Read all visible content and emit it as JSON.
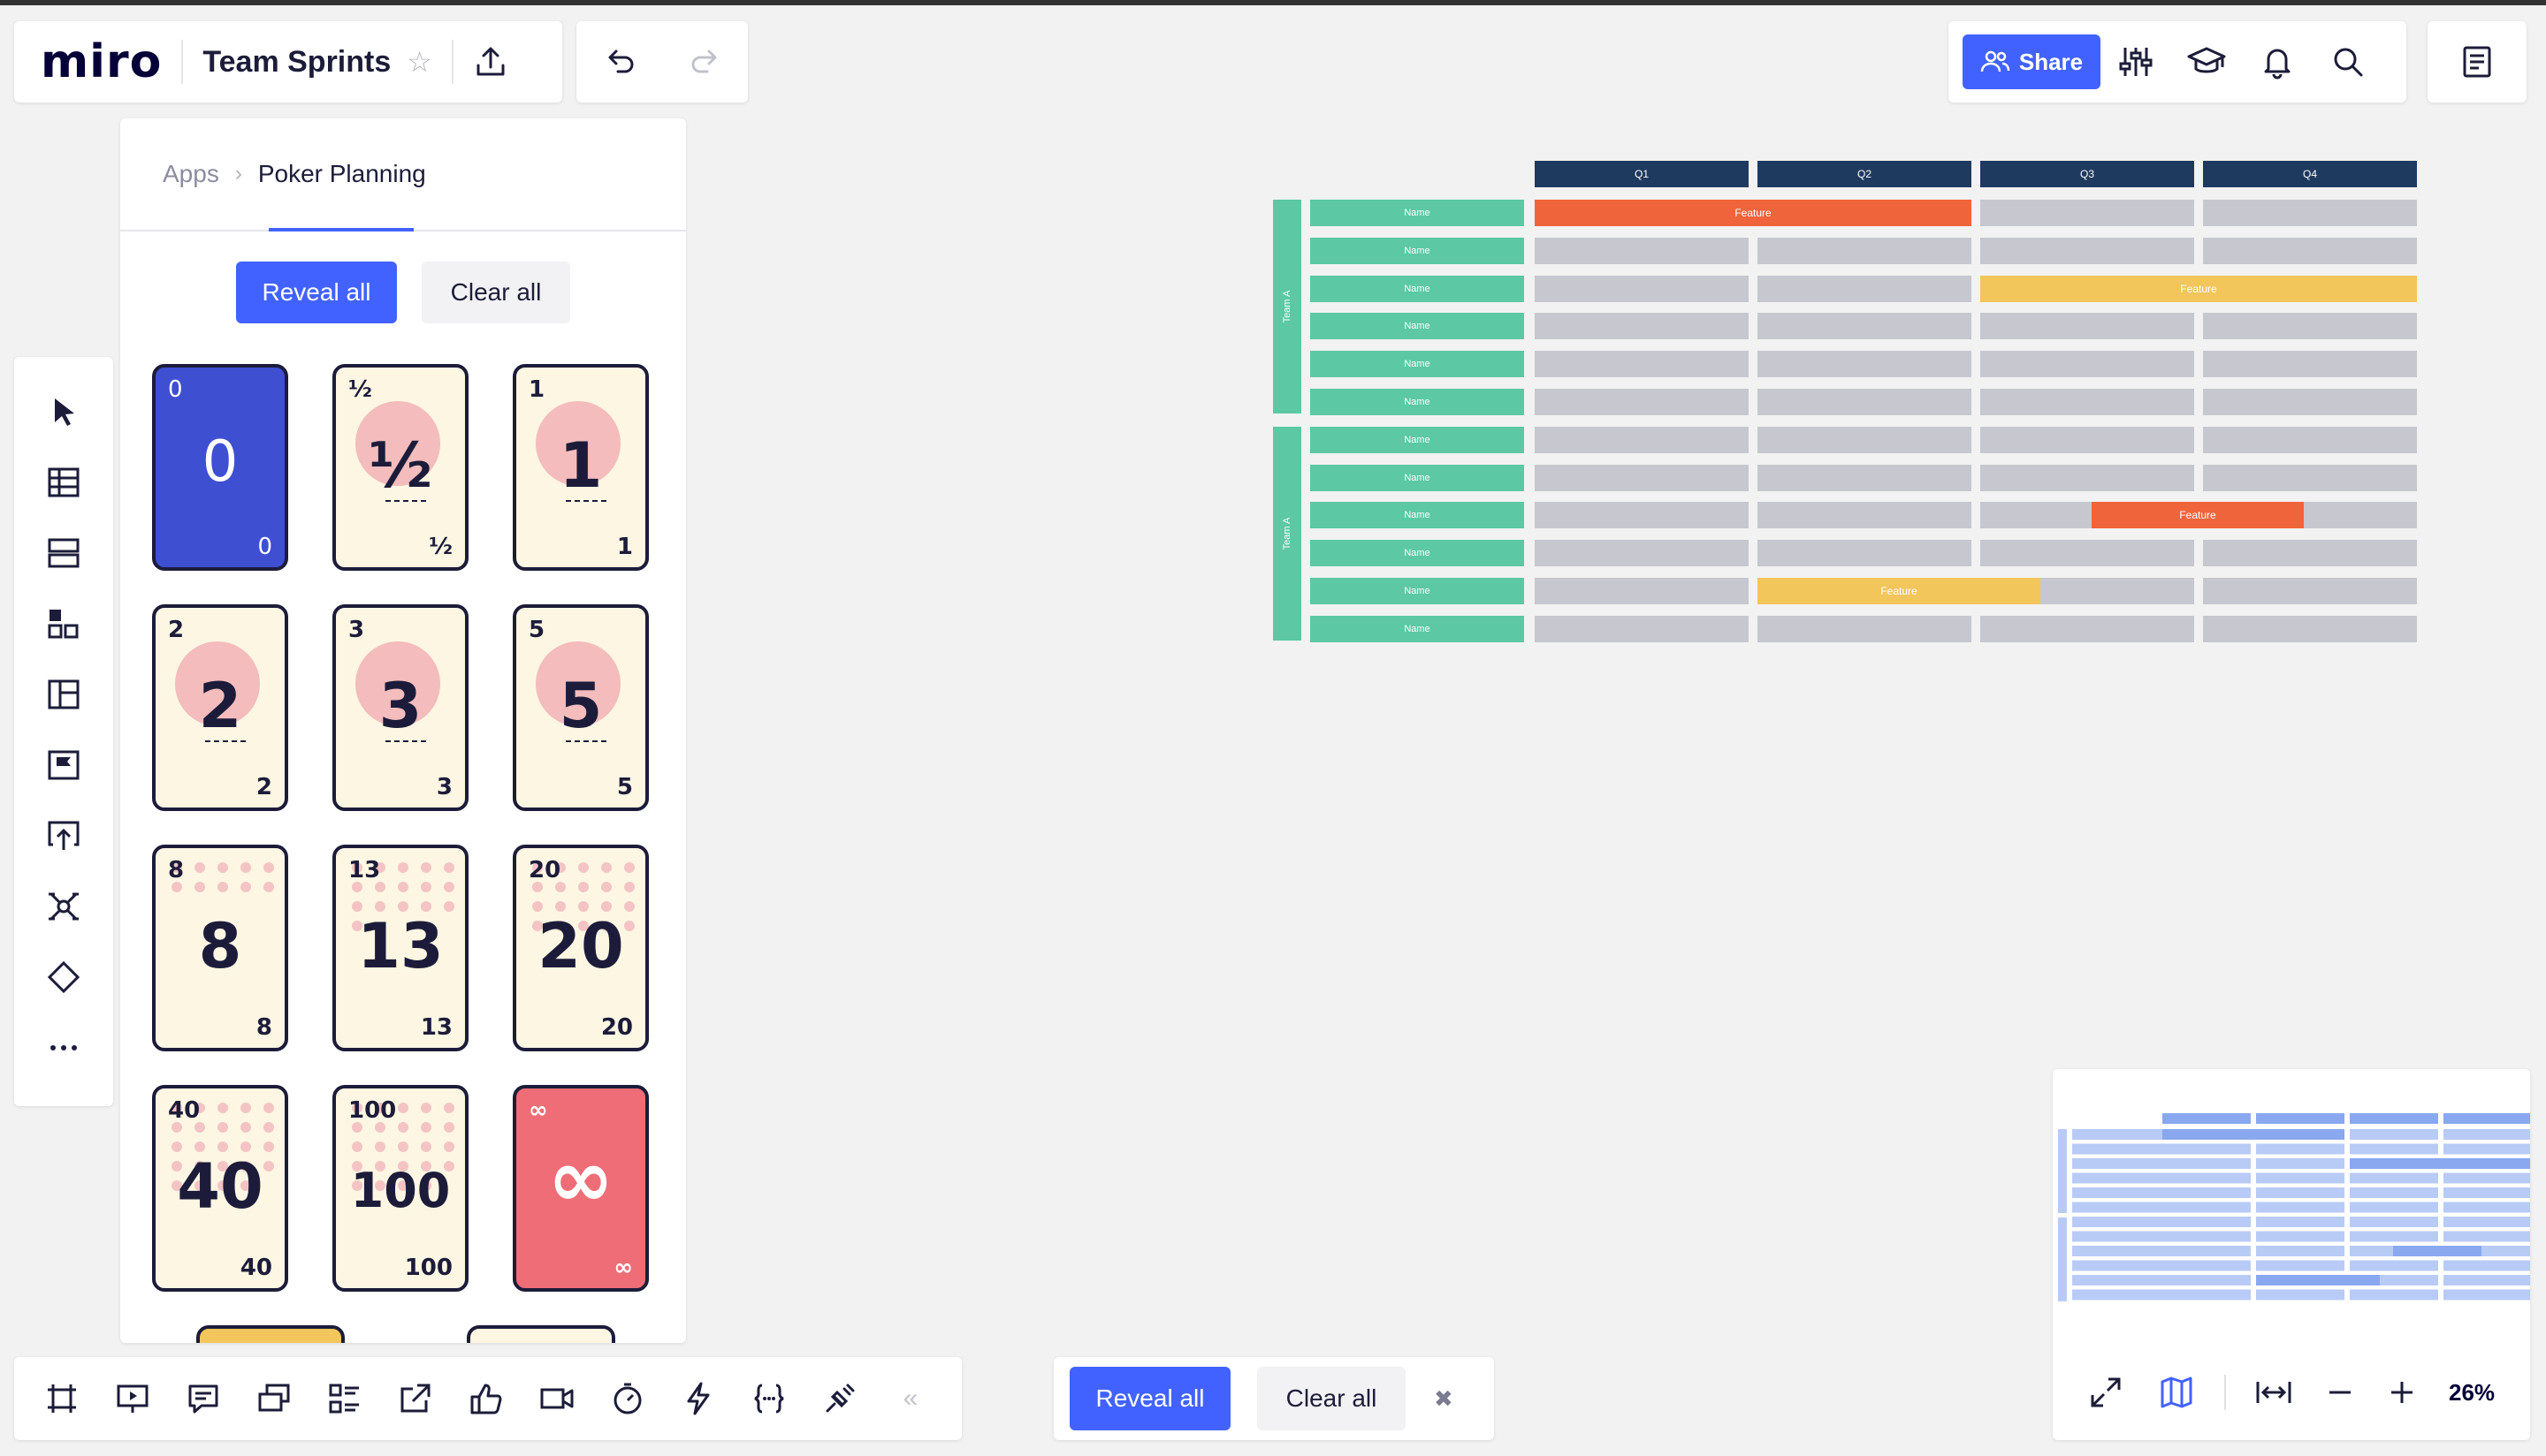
{
  "app": {
    "logo": "miro",
    "board_title": "Team Sprints"
  },
  "topbar": {
    "share_label": "Share"
  },
  "poker_panel": {
    "breadcrumb": [
      "Apps",
      "Poker Planning"
    ],
    "reveal_label": "Reveal all",
    "clear_label": "Clear all",
    "cards": [
      {
        "value": "0",
        "style": "blue"
      },
      {
        "value": "½",
        "style": "circle"
      },
      {
        "value": "1",
        "style": "circle"
      },
      {
        "value": "2",
        "style": "circle"
      },
      {
        "value": "3",
        "style": "circle"
      },
      {
        "value": "5",
        "style": "circle"
      },
      {
        "value": "8",
        "style": "dots"
      },
      {
        "value": "13",
        "style": "dots"
      },
      {
        "value": "20",
        "style": "dots"
      },
      {
        "value": "40",
        "style": "dots"
      },
      {
        "value": "100",
        "style": "dots"
      },
      {
        "value": "∞",
        "style": "red"
      }
    ]
  },
  "bottom_bar": {
    "reveal_label": "Reveal all",
    "clear_label": "Clear all"
  },
  "zoom": {
    "level": "26%"
  },
  "board": {
    "quarters": [
      "Q1",
      "Q2",
      "Q3",
      "Q4"
    ],
    "teams": [
      "Team A",
      "Team A"
    ],
    "row_label": "Name",
    "feature_label": "Feature",
    "colors": {
      "header": "#1f3a5f",
      "team": "#5cc8a4",
      "cell": "#c6c7cf",
      "orange": "#f0643c",
      "yellow": "#f2c65a"
    }
  },
  "colors": {
    "accent": "#4262ff",
    "canvas": "#f2f2f2"
  }
}
